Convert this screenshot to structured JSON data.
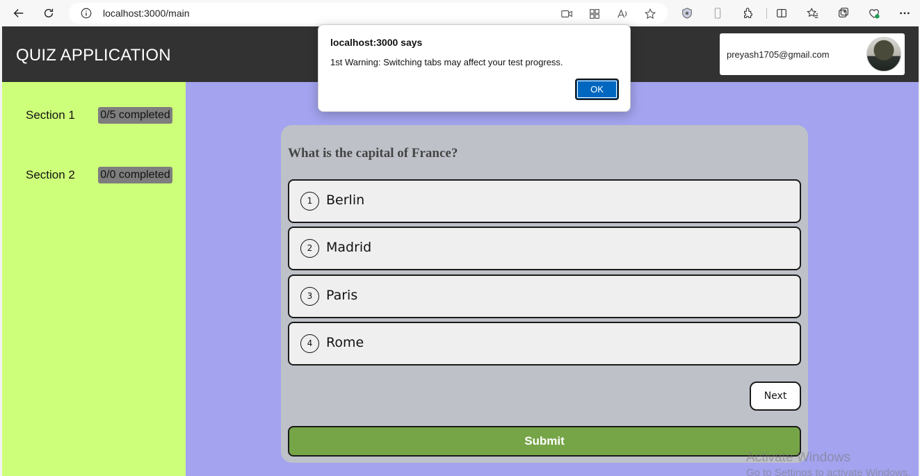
{
  "browser": {
    "url": "localhost:3000/main",
    "icons": [
      "back-icon",
      "refresh-icon",
      "site-info-icon",
      "video-icon",
      "apps-icon",
      "read-aloud-icon",
      "favorite-star-icon",
      "shield-icon",
      "phone-icon",
      "extensions-icon",
      "split-screen-icon",
      "favorites-icon",
      "collections-icon",
      "health-icon",
      "more-icon"
    ]
  },
  "header": {
    "title": "QUIZ APPLICATION",
    "user_email": "preyash1705@gmail.com",
    "colors": {
      "header_bg": "#323232",
      "title_text": "#ffffff"
    }
  },
  "sidebar": {
    "bg_color": "#ceff7a",
    "sections": [
      {
        "label": "Section 1",
        "status": "0/5 completed"
      },
      {
        "label": "Section 2",
        "status": "0/0 completed"
      }
    ]
  },
  "quiz": {
    "question": "What is the capital of France?",
    "options": [
      {
        "number": "1",
        "text": "Berlin"
      },
      {
        "number": "2",
        "text": "Madrid"
      },
      {
        "number": "3",
        "text": "Paris"
      },
      {
        "number": "4",
        "text": "Rome"
      }
    ],
    "next_label": "Next",
    "submit_label": "Submit",
    "colors": {
      "page_bg": "#a3a3ef",
      "card_bg": "#bec1c8",
      "submit_bg": "#76a548"
    }
  },
  "alert": {
    "title": "localhost:3000 says",
    "message": "1st Warning: Switching tabs may affect your test progress.",
    "ok_label": "OK",
    "ok_color": "#0067c0"
  },
  "watermark": {
    "line1": "Activate Windows",
    "line2": "Go to Settings to activate Windows."
  }
}
